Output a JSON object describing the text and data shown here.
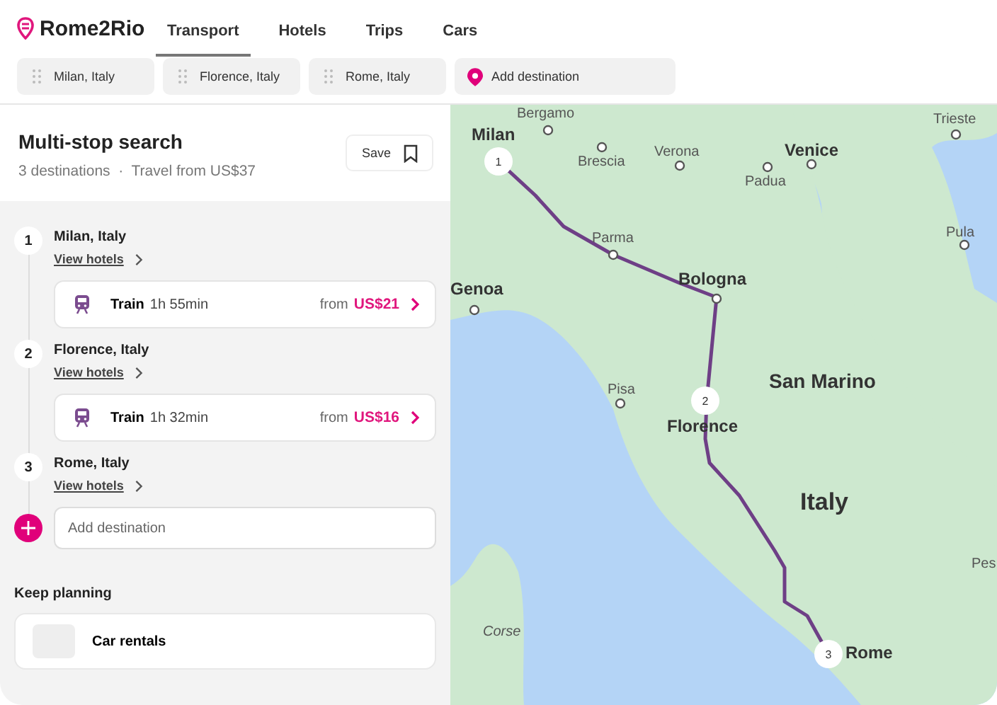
{
  "brand": "Rome2Rio",
  "tabs": [
    {
      "label": "Transport",
      "selected": true
    },
    {
      "label": "Hotels",
      "selected": false
    },
    {
      "label": "Trips",
      "selected": false
    },
    {
      "label": "Cars",
      "selected": false
    }
  ],
  "stops_bar": {
    "stops": [
      "Milan, Italy",
      "Florence, Italy",
      "Rome, Italy"
    ],
    "add": "Add destination"
  },
  "trip": {
    "title": "Multi-stop search",
    "summary": "3 destinations  ·  Travel from US$37",
    "save": "Save"
  },
  "itinerary": [
    {
      "kind": "stop",
      "number": "1",
      "name": "Milan, Italy",
      "link": "View hotels"
    },
    {
      "kind": "leg",
      "mode": "Train",
      "duration": "1h 55min",
      "from": "from",
      "price": "US$21"
    },
    {
      "kind": "stop",
      "number": "2",
      "name": "Florence, Italy",
      "link": "View hotels"
    },
    {
      "kind": "leg",
      "mode": "Train",
      "duration": "1h 32min",
      "from": "from",
      "price": "US$16"
    },
    {
      "kind": "stop",
      "number": "3",
      "name": "Rome, Italy",
      "link": "View hotels"
    }
  ],
  "add_destination": {
    "placeholder": "Add destination"
  },
  "keep_planning": {
    "title": "Keep planning",
    "items": [
      "Car rentals"
    ]
  },
  "map": {
    "labels": [
      {
        "text": "Bergamo",
        "kind": "town"
      },
      {
        "text": "Trieste",
        "kind": "town"
      },
      {
        "text": "Milan",
        "kind": "city"
      },
      {
        "text": "Brescia",
        "kind": "town"
      },
      {
        "text": "Verona",
        "kind": "town"
      },
      {
        "text": "Venice",
        "kind": "city"
      },
      {
        "text": "Padua",
        "kind": "town"
      },
      {
        "text": "Parma",
        "kind": "town"
      },
      {
        "text": "Pula",
        "kind": "town"
      },
      {
        "text": "Bologna",
        "kind": "city"
      },
      {
        "text": "Genoa",
        "kind": "city"
      },
      {
        "text": "Pisa",
        "kind": "town"
      },
      {
        "text": "San Marino",
        "kind": "country"
      },
      {
        "text": "Florence",
        "kind": "city"
      },
      {
        "text": "Italy",
        "kind": "nation"
      },
      {
        "text": "Pes",
        "kind": "town"
      },
      {
        "text": "Corse",
        "kind": "island"
      },
      {
        "text": "Rome",
        "kind": "city"
      }
    ],
    "markers": [
      "1",
      "2",
      "3"
    ]
  }
}
